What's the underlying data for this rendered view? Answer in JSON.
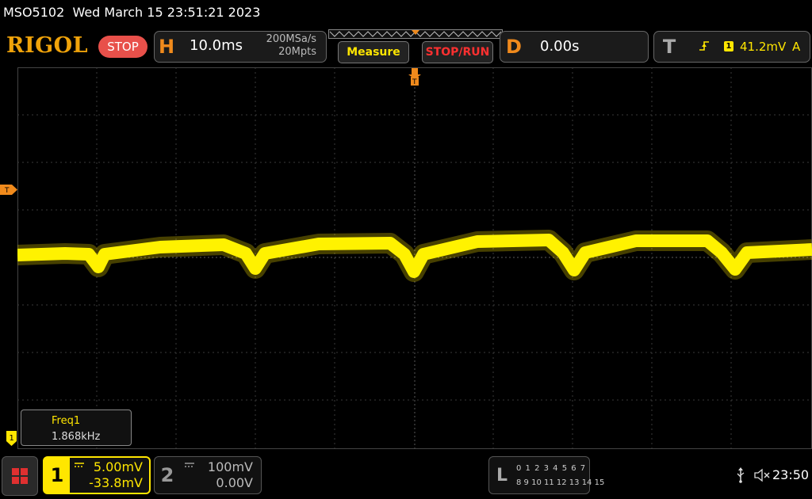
{
  "status": {
    "model": "MSO5102",
    "datetime": "Wed March 15 23:51:21 2023"
  },
  "brand": {
    "logo": "RIGOL",
    "run_state": "STOP"
  },
  "horizontal": {
    "letter": "H",
    "timebase": "10.0ms",
    "sample_rate": "200MSa/s",
    "memory_depth": "20Mpts"
  },
  "buttons": {
    "measure": "Measure",
    "stop_run": "STOP/RUN"
  },
  "delay": {
    "letter": "D",
    "value": "0.00s"
  },
  "trigger": {
    "letter": "T",
    "slope_icon": "rising-edge-icon",
    "source": "1",
    "level": "41.2mV",
    "mode": "A",
    "marker_label": "T"
  },
  "measurement": {
    "name": "Freq1",
    "value": "1.868kHz"
  },
  "channel1": {
    "number": "1",
    "scale": "5.00mV",
    "offset": "-33.8mV",
    "color": "#ffe600",
    "coupling_icon": "dc-coupling-icon"
  },
  "channel2": {
    "number": "2",
    "scale": "100mV",
    "offset": "0.00V",
    "coupling_icon": "dc-coupling-icon"
  },
  "logic": {
    "letter": "L",
    "row1": "0 1 2 3  4 5 6 7",
    "row2": "8 9 10 11 12 13 14 15"
  },
  "system": {
    "clock": "23:50",
    "usb_icon": "usb-icon",
    "sound_icon": "speaker-muted-icon"
  },
  "ground_marker": "1",
  "colors": {
    "accent_orange": "#f08a1c",
    "trace_yellow": "#ffe600",
    "stop_red": "#e8504a"
  }
}
